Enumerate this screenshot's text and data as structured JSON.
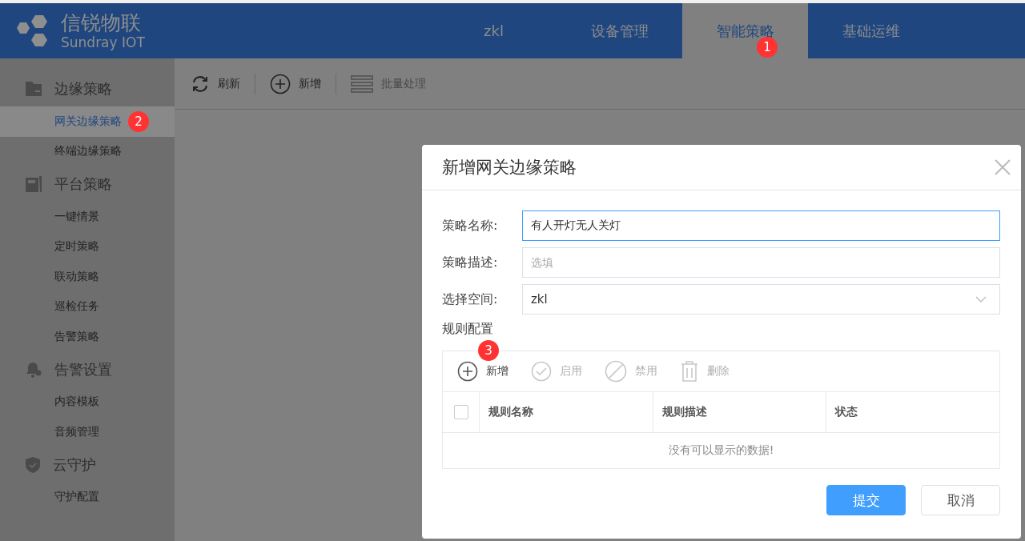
{
  "logo": {
    "title": "信锐物联",
    "subtitle": "Sundray IOT"
  },
  "nav_tabs": [
    {
      "label": "zkl",
      "selected": false
    },
    {
      "label": "设备管理",
      "selected": false
    },
    {
      "label": "智能策略",
      "selected": true,
      "badge": "1"
    },
    {
      "label": "基础运维",
      "selected": false
    }
  ],
  "sidebar": {
    "sections": [
      {
        "title": "边缘策略",
        "items": [
          {
            "label": "网关边缘策略",
            "selected": true,
            "badge": "2"
          },
          {
            "label": "终端边缘策略",
            "selected": false
          }
        ]
      },
      {
        "title": "平台策略",
        "items": [
          {
            "label": "一键情景",
            "selected": false
          },
          {
            "label": "定时策略",
            "selected": false
          },
          {
            "label": "联动策略",
            "selected": false
          },
          {
            "label": "巡检任务",
            "selected": false
          },
          {
            "label": "告警策略",
            "selected": false
          }
        ]
      },
      {
        "title": "告警设置",
        "items": [
          {
            "label": "内容模板",
            "selected": false
          },
          {
            "label": "音频管理",
            "selected": false
          }
        ]
      },
      {
        "title": "云守护",
        "items": [
          {
            "label": "守护配置",
            "selected": false
          }
        ]
      }
    ]
  },
  "toolbar": [
    {
      "label": "刷新",
      "disabled": false
    },
    {
      "label": "新增",
      "disabled": false
    },
    {
      "label": "批量处理",
      "disabled": true
    }
  ],
  "dialog": {
    "title": "新增网关边缘策略",
    "fields": [
      {
        "kind": "text",
        "label": "策略名称:",
        "value": "有人开灯无人关灯",
        "focused": true
      },
      {
        "kind": "text",
        "label": "策略描述:",
        "placeholder": "选填",
        "focused": false
      },
      {
        "kind": "select",
        "label": "选择空间:",
        "value": "zkl",
        "focused": false
      }
    ],
    "rules": {
      "title": "规则配置",
      "toolbar": [
        {
          "label": "新增",
          "disabled": false,
          "badge": "3"
        },
        {
          "label": "启用",
          "disabled": true
        },
        {
          "label": "禁用",
          "disabled": true
        },
        {
          "label": "删除",
          "disabled": true
        }
      ],
      "select_all": {
        "checked": false
      },
      "columns": [
        "规则名称",
        "规则描述",
        "状态"
      ],
      "empty_text": "没有可以显示的数据!"
    },
    "buttons": [
      {
        "label": "提交",
        "kind": "primary"
      },
      {
        "label": "取消",
        "kind": "default"
      }
    ]
  }
}
